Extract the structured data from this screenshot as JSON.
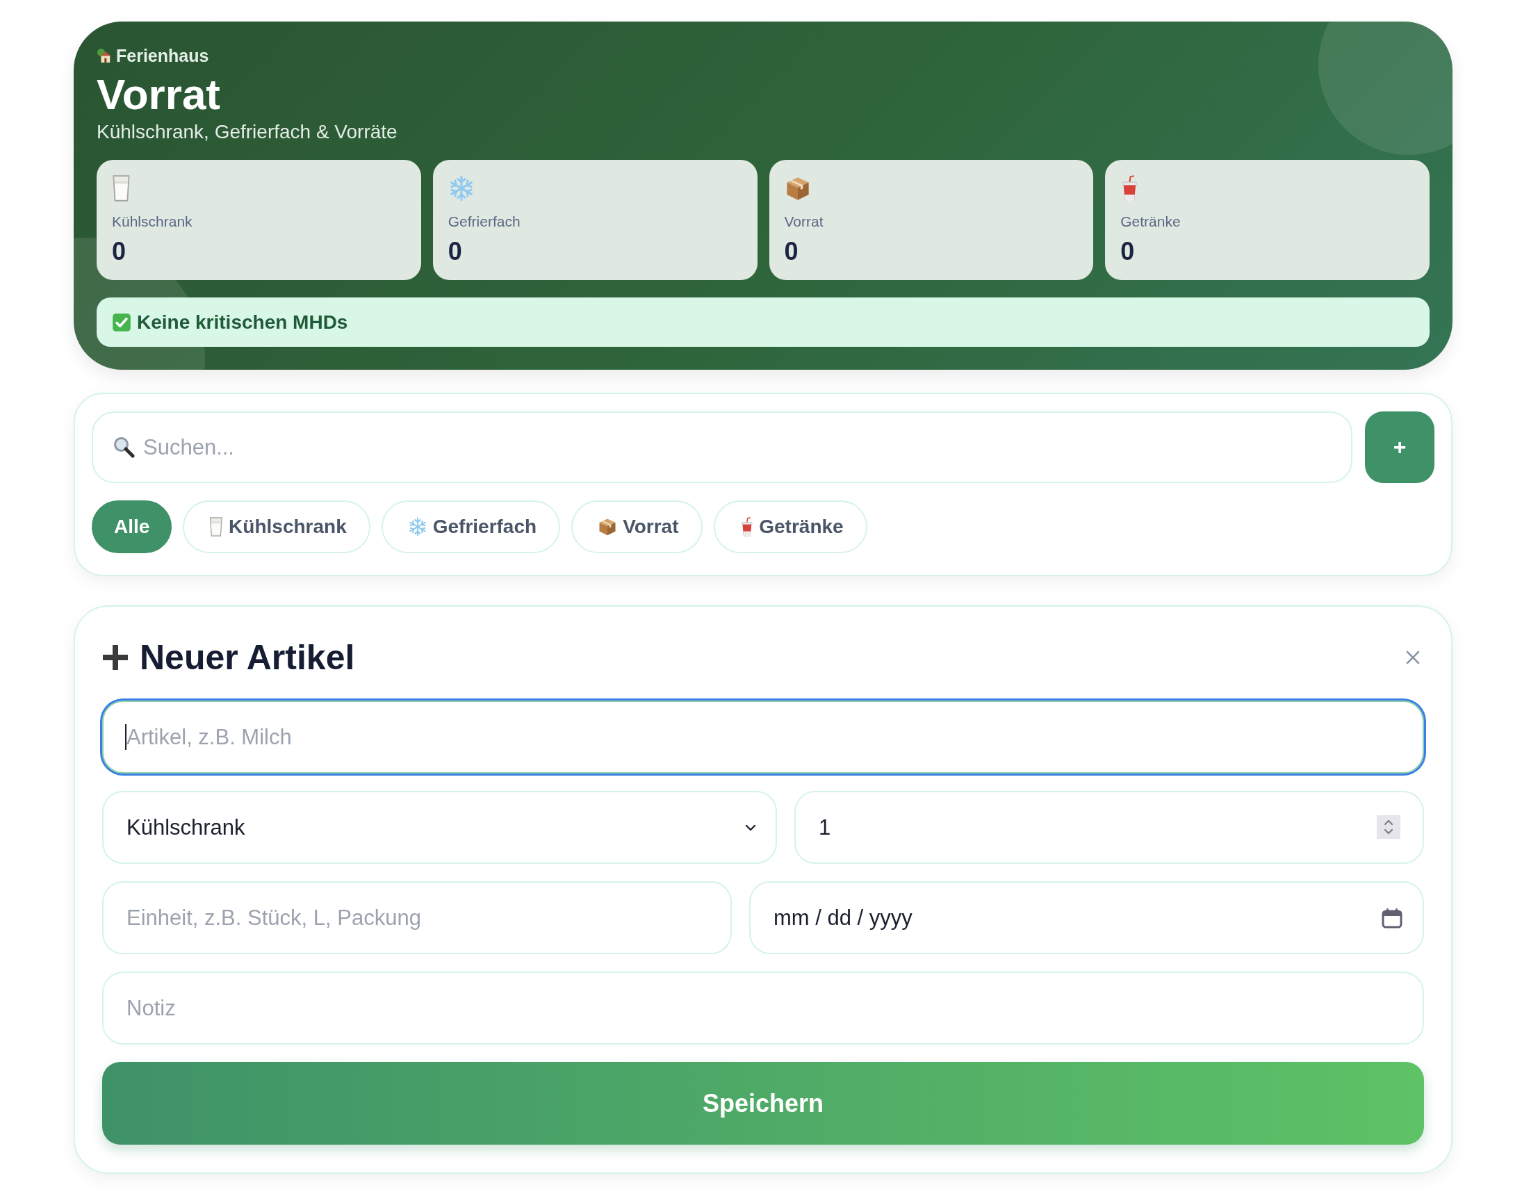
{
  "header": {
    "eyebrow": "Ferienhaus",
    "title": "Vorrat",
    "subtitle": "Kühlschrank, Gefrierfach & Vorräte",
    "stats": [
      {
        "kind": "glass",
        "label": "Kühlschrank",
        "value": "0"
      },
      {
        "kind": "snowflake",
        "label": "Gefrierfach",
        "value": "0"
      },
      {
        "kind": "box",
        "label": "Vorrat",
        "value": "0"
      },
      {
        "kind": "cup",
        "label": "Getränke",
        "value": "0"
      }
    ],
    "alert": {
      "kind": "ok",
      "text": "Keine kritischen MHDs"
    }
  },
  "toolbar": {
    "search": {
      "placeholder": "Suchen..."
    },
    "add_button": {
      "label": "+"
    },
    "filters": [
      {
        "kind": "all",
        "label": "Alle",
        "selected": true
      },
      {
        "kind": "glass",
        "label": "Kühlschrank",
        "selected": false
      },
      {
        "kind": "snowflake",
        "label": "Gefrierfach",
        "selected": false
      },
      {
        "kind": "box",
        "label": "Vorrat",
        "selected": false
      },
      {
        "kind": "cup",
        "label": "Getränke",
        "selected": false
      }
    ]
  },
  "form": {
    "title": "Neuer Artikel",
    "rows": [
      [
        {
          "kind": "text",
          "placeholder": "Artikel, z.B. Milch",
          "focused": true
        }
      ],
      [
        {
          "kind": "select",
          "value": "Kühlschrank"
        },
        {
          "kind": "number",
          "value": "1"
        }
      ],
      [
        {
          "kind": "text",
          "placeholder": "Einheit, z.B. Stück, L, Packung",
          "focused": false
        },
        {
          "kind": "date",
          "value": "mm / dd / yyyy"
        }
      ],
      [
        {
          "kind": "text",
          "placeholder": "Notiz",
          "focused": false
        }
      ]
    ],
    "submit": {
      "label": "Speichern"
    }
  }
}
